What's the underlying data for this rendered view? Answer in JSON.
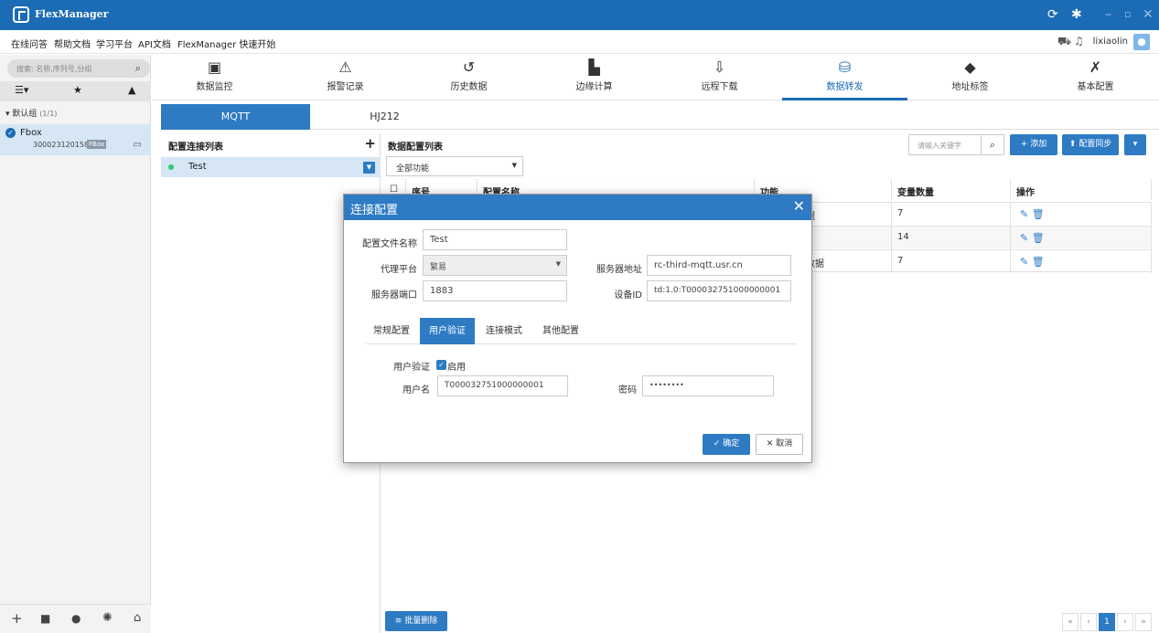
{
  "app": {
    "name": "FlexManager"
  },
  "menubar": {
    "items": [
      "在线问答",
      "帮助文档",
      "学习平台",
      "API文档",
      "FlexManager 快速开始"
    ],
    "user": "lixiaolin"
  },
  "sidebar": {
    "search_placeholder": "搜索: 名称,序列号,分组",
    "group": "默认组",
    "group_count": "(1/1)",
    "device": {
      "name": "Fbox",
      "sn": "300023120158",
      "badge": "FBox"
    }
  },
  "topnav": {
    "items": [
      {
        "label": "数据监控",
        "icon": "monitor-icon"
      },
      {
        "label": "报警记录",
        "icon": "alarm-icon"
      },
      {
        "label": "历史数据",
        "icon": "history-icon"
      },
      {
        "label": "边缘计算",
        "icon": "code-icon"
      },
      {
        "label": "远程下载",
        "icon": "download-icon"
      },
      {
        "label": "数据转发",
        "icon": "database-forward-icon"
      },
      {
        "label": "地址标签",
        "icon": "tag-icon"
      },
      {
        "label": "基本配置",
        "icon": "tools-icon"
      }
    ],
    "active_index": 5
  },
  "protocol_tabs": [
    "MQTT",
    "HJ212"
  ],
  "connlist": {
    "header": "配置连接列表",
    "rows": [
      {
        "name": "Test",
        "status": "online"
      }
    ]
  },
  "datapanel": {
    "header": "数据配置列表",
    "keyword_placeholder": "请输入关键字",
    "add_label": "+ 添加",
    "sync_label": "配置同步",
    "filter": "全部功能",
    "columns": [
      "序号",
      "配置名称",
      "功能",
      "变量数量",
      "操作"
    ],
    "rows": [
      {
        "func": "数据",
        "count": "7"
      },
      {
        "func": "据",
        "count": "14"
      },
      {
        "func": "点数据",
        "count": "7"
      }
    ],
    "batch_delete": "批量删除",
    "current_page": "1"
  },
  "modal": {
    "title": "连接配置",
    "fields": {
      "config_name_label": "配置文件名称",
      "config_name": "Test",
      "platform_label": "代理平台",
      "platform": "繁易",
      "server_addr_label": "服务器地址",
      "server_addr": "rc-third-mqtt.usr.cn",
      "port_label": "服务器端口",
      "port": "1883",
      "device_id_label": "设备ID",
      "device_id": "td:1.0:T000032751000000001"
    },
    "tabs": [
      "常规配置",
      "用户验证",
      "连接模式",
      "其他配置"
    ],
    "active_tab": 1,
    "auth": {
      "label": "用户验证",
      "enable_label": "启用",
      "enabled": true,
      "username_label": "用户名",
      "username": "T000032751000000001",
      "password_label": "密码",
      "password": "••••••••"
    },
    "ok_label": "确定",
    "cancel_label": "取消"
  }
}
